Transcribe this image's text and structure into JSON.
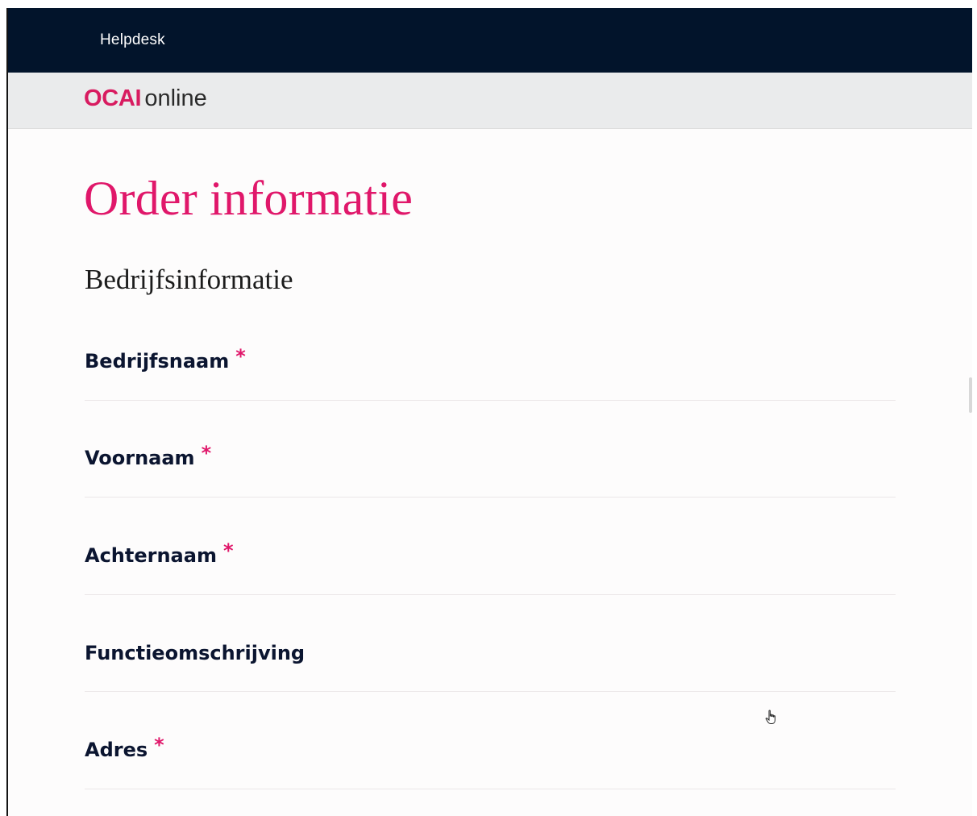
{
  "topbar": {
    "helpdesk_label": "Helpdesk"
  },
  "brand": {
    "logo_ocai": "OCAI",
    "logo_online": "online",
    "accent_color": "#e0176a",
    "nav_color": "#02142b"
  },
  "main": {
    "page_title": "Order informatie",
    "section_title": "Bedrijfsinformatie",
    "fields": [
      {
        "label": "Bedrijfsnaam",
        "required": "*"
      },
      {
        "label": "Voornaam",
        "required": "*"
      },
      {
        "label": "Achternaam",
        "required": "*"
      },
      {
        "label": "Functieomschrijving",
        "required": ""
      },
      {
        "label": "Adres",
        "required": "*"
      }
    ]
  },
  "pointer": {
    "icon": "hand-pointer-icon"
  }
}
